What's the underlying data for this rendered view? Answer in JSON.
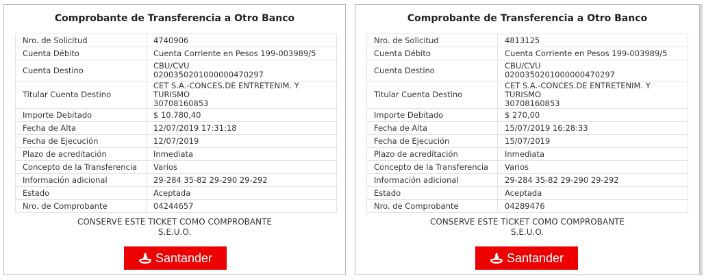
{
  "receipts": [
    {
      "title": "Comprobante de Transferencia a Otro Banco",
      "rows": [
        {
          "label": "Nro. de Solicitud",
          "value": "4740906"
        },
        {
          "label": "Cuenta Débito",
          "value": "Cuenta Corriente en Pesos 199-003989/5"
        },
        {
          "label": "Cuenta Destino",
          "value": "CBU/CVU",
          "value2": "0200350201000000470297"
        },
        {
          "label": "Titular Cuenta Destino",
          "value": "CET S.A.-CONCES.DE ENTRETENIM. Y TURISMO",
          "value2": "30708160853"
        },
        {
          "label": "Importe Debitado",
          "value": "$ 10.780,40"
        },
        {
          "label": "Fecha de Alta",
          "value": "12/07/2019 17:31:18"
        },
        {
          "label": "Fecha de Ejecución",
          "value": "12/07/2019"
        },
        {
          "label": "Plazo de acreditación",
          "value": "Inmediata"
        },
        {
          "label": "Concepto de la Transferencia",
          "value": "Varios"
        },
        {
          "label": "Información adicional",
          "value": "29-284 35-82 29-290 29-292"
        },
        {
          "label": "Estado",
          "value": "Aceptada"
        },
        {
          "label": "Nro. de Comprobante",
          "value": "04244657"
        }
      ],
      "footer_line1": "CONSERVE ESTE TICKET COMO COMPROBANTE",
      "footer_line2": "S.E.U.O.",
      "logo_text": "Santander"
    },
    {
      "title": "Comprobante de Transferencia a Otro Banco",
      "rows": [
        {
          "label": "Nro. de Solicitud",
          "value": "4813125"
        },
        {
          "label": "Cuenta Débito",
          "value": "Cuenta Corriente en Pesos 199-003989/5"
        },
        {
          "label": "Cuenta Destino",
          "value": "CBU/CVU",
          "value2": "0200350201000000470297"
        },
        {
          "label": "Titular Cuenta Destino",
          "value": "CET S.A.-CONCES.DE ENTRETENIM. Y TURISMO",
          "value2": "30708160853"
        },
        {
          "label": "Importe Debitado",
          "value": "$ 270,00"
        },
        {
          "label": "Fecha de Alta",
          "value": "15/07/2019 16:28:33"
        },
        {
          "label": "Fecha de Ejecución",
          "value": "15/07/2019"
        },
        {
          "label": "Plazo de acreditación",
          "value": "Inmediata"
        },
        {
          "label": "Concepto de la Transferencia",
          "value": "Varios"
        },
        {
          "label": "Información adicional",
          "value": "29-284 35-82 29-290 29-292"
        },
        {
          "label": "Estado",
          "value": "Aceptada"
        },
        {
          "label": "Nro. de Comprobante",
          "value": "04289476"
        }
      ],
      "footer_line1": "CONSERVE ESTE TICKET COMO COMPROBANTE",
      "footer_line2": "S.E.U.O.",
      "logo_text": "Santander"
    }
  ],
  "colors": {
    "brand_red": "#ec0000",
    "border": "#e4e4e4"
  },
  "icons": {
    "logo": "santander-flame-icon"
  }
}
